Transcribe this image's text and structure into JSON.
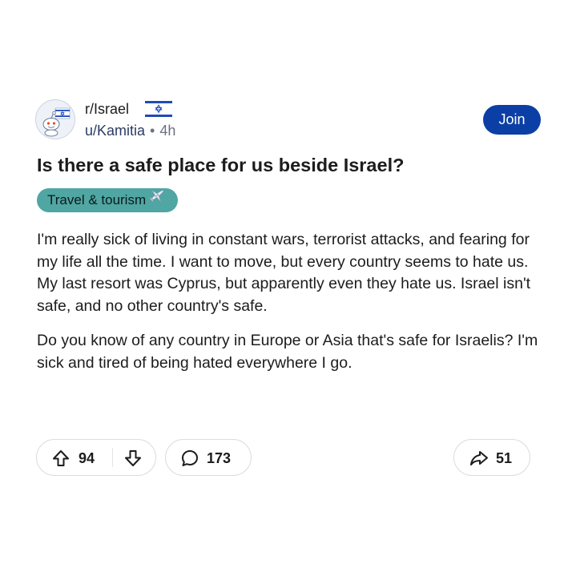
{
  "header": {
    "subreddit": "r/Israel",
    "username": "u/Kamitia",
    "separator": "•",
    "time": "4h",
    "join_label": "Join",
    "avatar_icon": "reddit-snoo-avatar-icon",
    "flag_icon": "israel-flag-icon"
  },
  "post": {
    "title": "Is there a safe place for us beside Israel?",
    "flair": {
      "label": "Travel & tourism",
      "icon": "airplane-icon",
      "color": "#4fa6a3"
    },
    "paragraphs": [
      "I'm really sick of living in constant wars, terrorist attacks, and fearing for my life all the time. I want to move, but every country seems to hate us. My last resort was Cyprus, but apparently even they hate us. Israel isn't safe, and no other country's safe.",
      "Do you know of any country in Europe or Asia that's safe for Israelis? I'm sick and tired of being hated everywhere I go."
    ]
  },
  "actions": {
    "upvotes": "94",
    "comments": "173",
    "shares": "51",
    "upvote_icon": "upvote-arrow-icon",
    "downvote_icon": "downvote-arrow-icon",
    "comment_icon": "speech-bubble-icon",
    "share_icon": "share-arrow-icon"
  },
  "colors": {
    "join_button": "#0b3fa5",
    "flair_background": "#4fa6a3",
    "username": "#2a3c63",
    "flag_blue": "#1f4bb8"
  }
}
